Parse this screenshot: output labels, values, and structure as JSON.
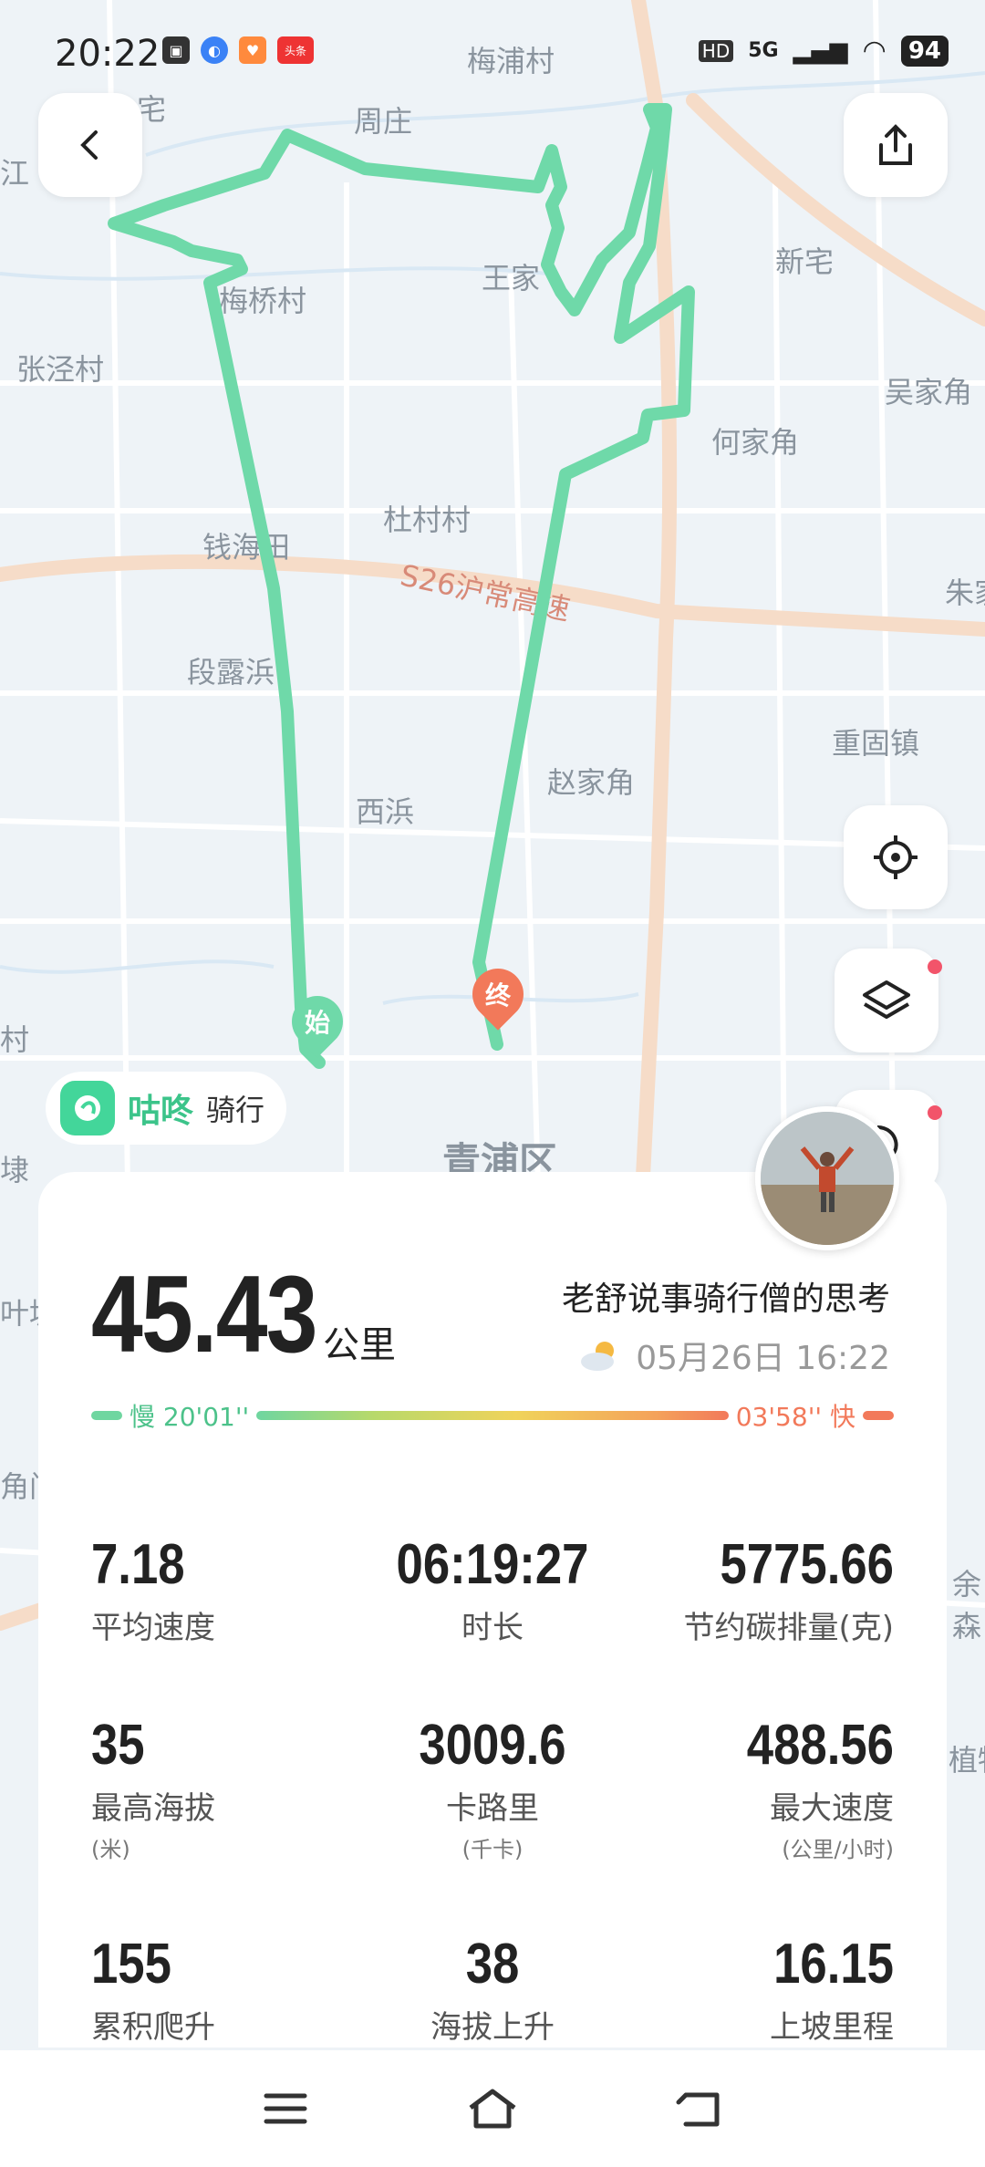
{
  "status_bar": {
    "time": "20:22",
    "network": "5G",
    "hd": "HD",
    "battery": "94",
    "news_badge": "头条"
  },
  "map": {
    "labels": [
      "梅浦村",
      "周庄",
      "新宅",
      "王家",
      "梅桥村",
      "张泾村",
      "吴家角",
      "何家角",
      "杜村村",
      "钱海田",
      "S26沪常高速",
      "朱家",
      "段露浜",
      "重固镇",
      "西浜",
      "赵家角",
      "青浦区",
      "江",
      "宅",
      "村",
      "埭",
      "叶塘",
      "角门",
      "余森",
      "植物"
    ],
    "start_pin": "始",
    "end_pin": "终",
    "route_color": "#6fd9a9"
  },
  "brand": {
    "name": "咕咚",
    "sub": "骑行"
  },
  "summary": {
    "distance": "45.43",
    "distance_unit": "公里",
    "author": "老舒说事骑行僧的思考",
    "datetime": "05月26日 16:22",
    "pace_slow": "慢 20'01''",
    "pace_fast": "03'58'' 快"
  },
  "stats": [
    {
      "value": "7.18",
      "label": "平均速度",
      "unit": ""
    },
    {
      "value": "06:19:27",
      "label": "时长",
      "unit": ""
    },
    {
      "value": "5775.66",
      "label": "节约碳排量(克)",
      "unit": ""
    },
    {
      "value": "35",
      "label": "最高海拔",
      "unit": "(米)"
    },
    {
      "value": "3009.6",
      "label": "卡路里",
      "unit": "(千卡)"
    },
    {
      "value": "488.56",
      "label": "最大速度",
      "unit": "(公里/小时)"
    },
    {
      "value": "155",
      "label": "累积爬升",
      "unit": ""
    },
    {
      "value": "38",
      "label": "海拔上升",
      "unit": ""
    },
    {
      "value": "16.15",
      "label": "上坡里程",
      "unit": ""
    }
  ],
  "colors": {
    "accent_green": "#3cc48a",
    "pace_fast": "#f2795a",
    "end_pin": "#f2795a",
    "start_pin": "#6fd9a9"
  }
}
